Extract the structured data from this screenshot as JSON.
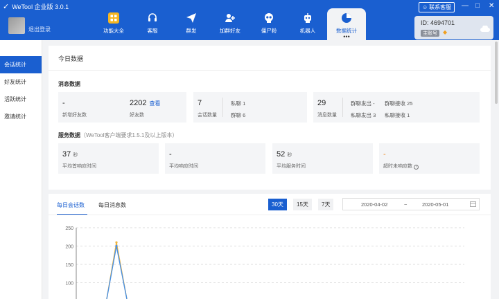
{
  "window": {
    "title": "WeTool 企业版 3.0.1",
    "help_label": "联系客服",
    "controls": [
      "—",
      "□",
      "✕"
    ]
  },
  "user": {
    "logout_label": "退出登录"
  },
  "nav": {
    "items": [
      {
        "label": "功能大全",
        "icon": "grid-icon"
      },
      {
        "label": "客服",
        "icon": "headset-icon"
      },
      {
        "label": "群发",
        "icon": "send-icon"
      },
      {
        "label": "加群好友",
        "icon": "add-group-icon"
      },
      {
        "label": "僵尸粉",
        "icon": "skull-icon"
      },
      {
        "label": "机器人",
        "icon": "robot-icon"
      },
      {
        "label": "数据统计",
        "icon": "pie-chart-icon"
      }
    ],
    "active_index": 6,
    "more_label": "•••"
  },
  "account": {
    "id_label": "ID: 4694701",
    "role_label": "主账号"
  },
  "sidebar": {
    "items": [
      "会话统计",
      "好友统计",
      "活跃统计",
      "邀请统计"
    ],
    "active_index": 0
  },
  "today": {
    "title": "今日数据",
    "message_section": "消息数据",
    "service_section": "服务数据",
    "service_note": "（WeTool客户端要求1.5.1及以上版本）",
    "cards": {
      "new_friends": {
        "value": "-",
        "label": "新增好友数"
      },
      "friends": {
        "value": "2202",
        "link": "查看",
        "label": "好友数"
      },
      "sessions": {
        "value": "7",
        "label": "会话数量",
        "private": "私聊 1",
        "group": "群聊 6"
      },
      "messages": {
        "value": "29",
        "label": "消息数量",
        "group_sent": "群聊发出 -",
        "group_recv": "群聊接收 25",
        "private_sent": "私聊发出 3",
        "private_recv": "私聊接收 1"
      },
      "first_resp": {
        "value": "37",
        "unit": "秒",
        "label": "平均首响应时间"
      },
      "avg_resp": {
        "value": "-",
        "label": "平均响应时间"
      },
      "avg_service": {
        "value": "52",
        "unit": "秒",
        "label": "平均服务时间"
      },
      "timeout": {
        "value": "-",
        "label": "超时未响应数"
      }
    }
  },
  "chart_panel": {
    "tabs": [
      "每日会话数",
      "每日消息数"
    ],
    "active_tab": 0,
    "ranges": [
      "30天",
      "15天",
      "7天"
    ],
    "active_range": 0,
    "date_start": "2020-04-02",
    "date_sep": "~",
    "date_end": "2020-05-01"
  },
  "chart_data": {
    "type": "line",
    "yticks": [
      250,
      200,
      150,
      100,
      50
    ],
    "ylim": [
      0,
      250
    ],
    "series": [
      {
        "color": "#f0b43c",
        "peak": 210
      },
      {
        "color": "#4a90e2",
        "peak": 200
      }
    ],
    "colors": {
      "accent": "#1a5fd0"
    }
  }
}
